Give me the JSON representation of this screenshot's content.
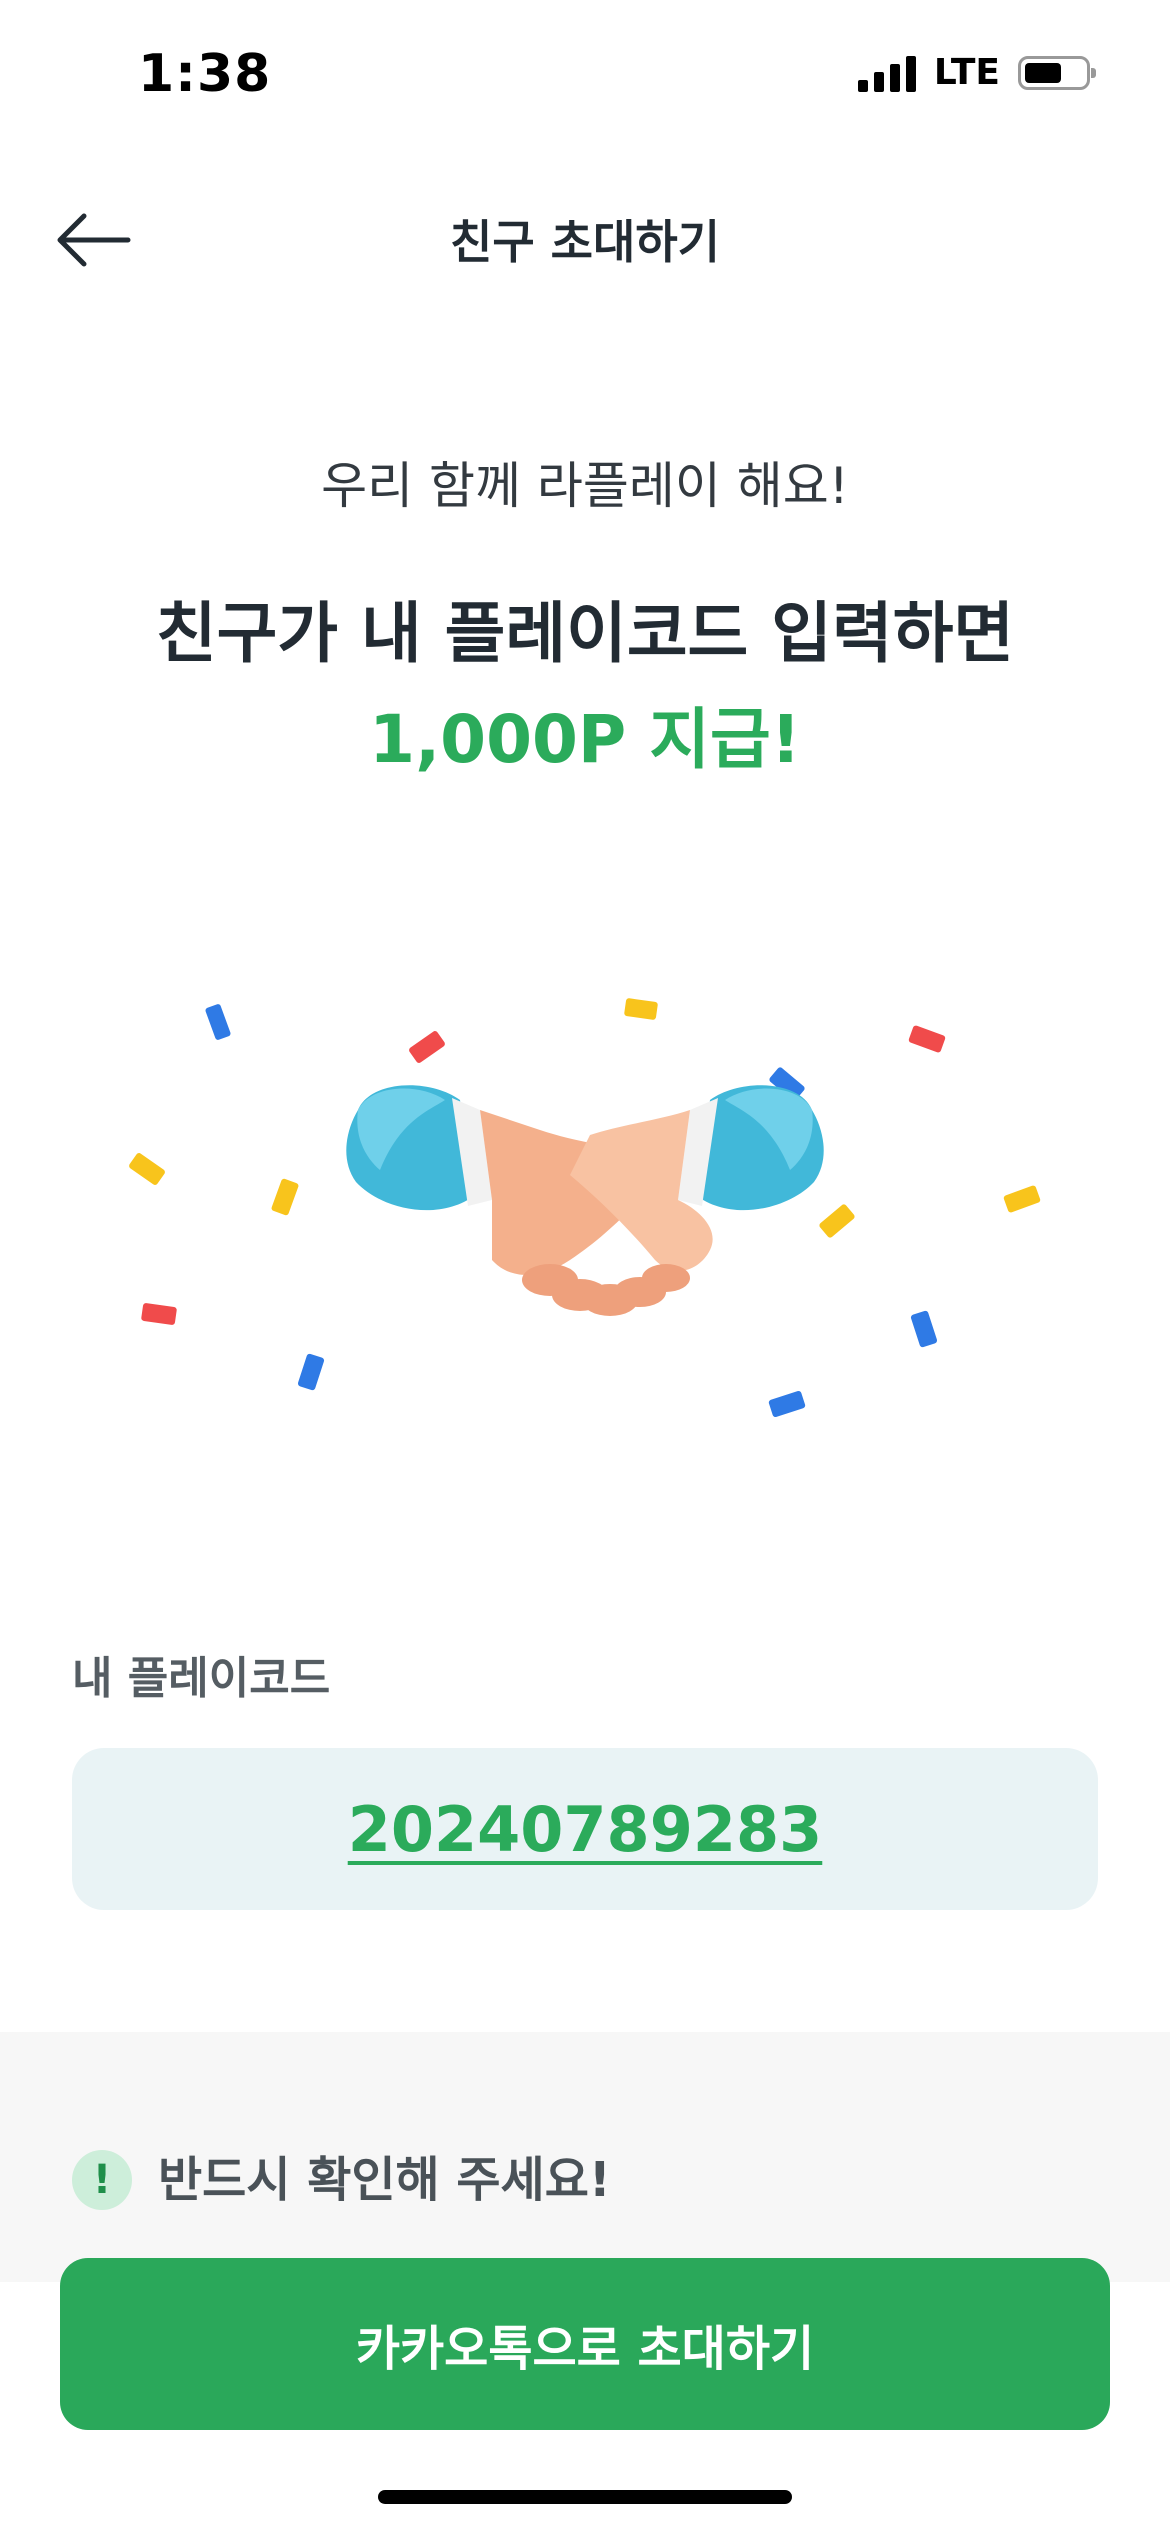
{
  "status_bar": {
    "time": "1:38",
    "network": "LTE"
  },
  "header": {
    "back_icon": "arrow-left-icon",
    "title": "친구 초대하기"
  },
  "hero": {
    "subtitle": "우리 함께 라플레이 해요!",
    "headline": "친구가 내 플레이코드 입력하면",
    "reward": "1,000P 지급!",
    "illustration": "handshake-with-confetti"
  },
  "my_code": {
    "label": "내 플레이코드",
    "value": "20240789283"
  },
  "notice": {
    "icon": "exclamation-icon",
    "text": "반드시 확인해 주세요!"
  },
  "cta": {
    "label": "카카오톡으로 초대하기"
  },
  "colors": {
    "accent_green": "#2aa85a",
    "code_box_bg": "#e9f3f5",
    "notice_bg": "#f7f7f7"
  }
}
